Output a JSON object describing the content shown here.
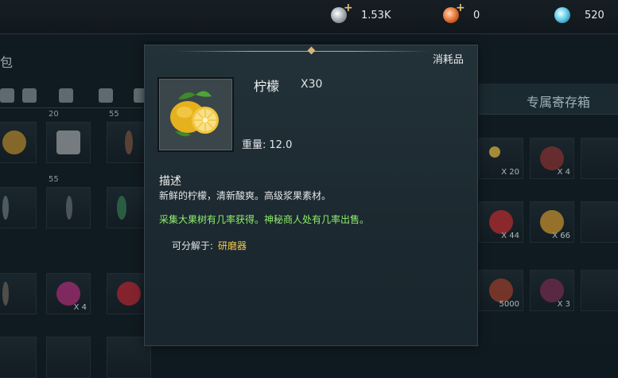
{
  "currencies": [
    {
      "icon": "silver-coin-icon",
      "value": "1.53K",
      "has_plus": true
    },
    {
      "icon": "copper-coin-icon",
      "value": "0",
      "has_plus": true
    },
    {
      "icon": "crystal-icon",
      "value": "520",
      "has_plus": false
    }
  ],
  "background": {
    "bag_label": "包",
    "storage_tab_label": "专属寄存箱",
    "left_slots": [
      {
        "num": "20",
        "qty": ""
      },
      {
        "num": "55",
        "qty": ""
      },
      {
        "num": "55",
        "qty": ""
      },
      {
        "num": "",
        "qty": "X 4"
      }
    ],
    "right_slots": [
      {
        "qty": "X 20"
      },
      {
        "qty": "X 4"
      },
      {
        "qty": "X 44"
      },
      {
        "qty": "X 66"
      },
      {
        "qty": "5000"
      },
      {
        "qty": "X 3"
      }
    ]
  },
  "tooltip": {
    "category": "消耗品",
    "item_name": "柠檬",
    "item_qty": "X30",
    "weight_label": "重量:",
    "weight_value": "12.0",
    "desc_title": "描述",
    "desc_text": "新鲜的柠檬，清新酸爽。高级浆果素材。",
    "source_text": "采集大果树有几率获得。神秘商人处有几率出售。",
    "decompose_label": "可分解于:",
    "decompose_value": "研磨器",
    "icon": "lemon-icon"
  },
  "colors": {
    "source_text": "#8ff06b",
    "decompose_value": "#f5c84a",
    "panel_bg": "#1c2930"
  }
}
